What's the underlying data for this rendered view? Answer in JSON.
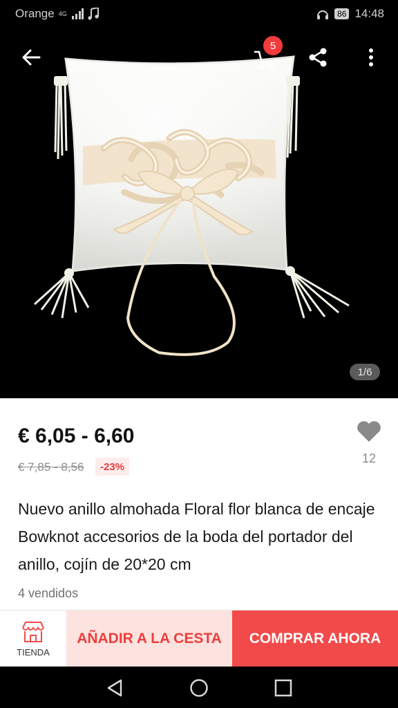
{
  "status": {
    "carrier": "Orange",
    "network": "4G",
    "battery": "86",
    "time": "14:48"
  },
  "header": {
    "cart_count": "5",
    "image_counter": "1/6",
    "icons": [
      "back-arrow-icon",
      "cart-icon",
      "share-icon",
      "more-vert-icon"
    ]
  },
  "product": {
    "price": "€ 6,05 - 6,60",
    "old_price": "€ 7,85 - 8,56",
    "discount": "-23%",
    "wishlist_count": "12",
    "title": "Nuevo anillo almohada Floral flor blanca de encaje Bowknot accesorios de la boda del portador del anillo, cojín de 20*20 cm",
    "sold": "4 vendidos"
  },
  "actions": {
    "store_label": "TIENDA",
    "add_to_cart": "AÑADIR A LA CESTA",
    "buy_now": "COMPRAR AHORA"
  },
  "colors": {
    "accent": "#f24a4a",
    "accent_light": "#fde3df",
    "discount_bg": "#fdecec"
  }
}
